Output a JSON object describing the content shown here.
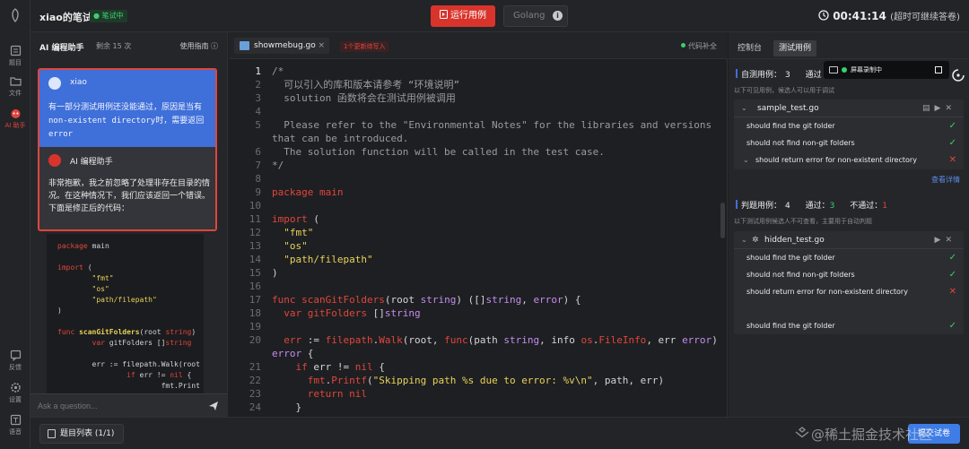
{
  "colors": {
    "accent_red": "#d9342b",
    "accent_blue": "#3f6fd8",
    "success": "#3ccf6e",
    "background": "#1e1f22"
  },
  "rail": {
    "items": [
      {
        "label": "题目",
        "icon": "question-icon"
      },
      {
        "label": "文件",
        "icon": "folder-icon"
      },
      {
        "label": "AI 助手",
        "icon": "robot-icon"
      },
      {
        "label": "反馈",
        "icon": "feedback-icon"
      },
      {
        "label": "设置",
        "icon": "gear-icon"
      },
      {
        "label": "语音",
        "icon": "speech-icon"
      }
    ]
  },
  "topbar": {
    "title": "xiao的笔试",
    "badge": "笔试中",
    "run_button": "运行用例",
    "language": "Golang",
    "timer": "00:41:14",
    "timer_note": "(超时可继续答卷)"
  },
  "ai": {
    "title": "AI 编程助手",
    "remaining": "剩余 15 次",
    "guide": "使用指南",
    "user_name": "xiao",
    "user_message": "有一部分测试用例还没能通过，原因是当有 non-existent directory时，需要返回 error",
    "bot_name": "AI 编程助手",
    "bot_message": "非常抱歉，我之前忽略了处理非存在目录的情况。在这种情况下，我们应该返回一个错误。下面是修正后的代码：",
    "ask_placeholder": "Ask a question..."
  },
  "editor": {
    "file_tab": "showmebug.go",
    "unsaved": "1个更新待写入",
    "autocomplete": "代码补全",
    "current_line": 1
  },
  "tests": {
    "tab_console": "控制台",
    "tab_cases": "测试用例",
    "self_label": "自测用例：",
    "self_count": "3",
    "self_pass_label": "通过",
    "self_sub": "以下可见用例，候选人可以用于调试",
    "sample_file": "sample_test.go",
    "sample_cases": [
      {
        "name": "should find the git folder",
        "status": "pass"
      },
      {
        "name": "should not find non-git folders",
        "status": "pass"
      },
      {
        "name": "should return error for non-existent directory",
        "status": "fail"
      }
    ],
    "details_link": "查看详情",
    "judge_label": "判题用例：",
    "judge_count": "4",
    "judge_pass_label": "通过：",
    "judge_pass": "3",
    "judge_fail_label": "不通过：",
    "judge_fail": "1",
    "judge_sub": "以下测试用例候选人不可查看，主要用于自动判题",
    "hidden_file": "hidden_test.go",
    "hidden_cases": [
      {
        "name": "should find the git folder",
        "status": "pass"
      },
      {
        "name": "should not find non-git folders",
        "status": "pass"
      },
      {
        "name": "should return error for non-existent directory",
        "status": "fail"
      },
      {
        "name": "should find the git folder",
        "status": "pass"
      }
    ],
    "recording": "屏幕录制中"
  },
  "bottombar": {
    "question_list": "题目列表 (1/1)",
    "submit": "提交试卷",
    "watermark": "@稀土掘金技术社区"
  }
}
